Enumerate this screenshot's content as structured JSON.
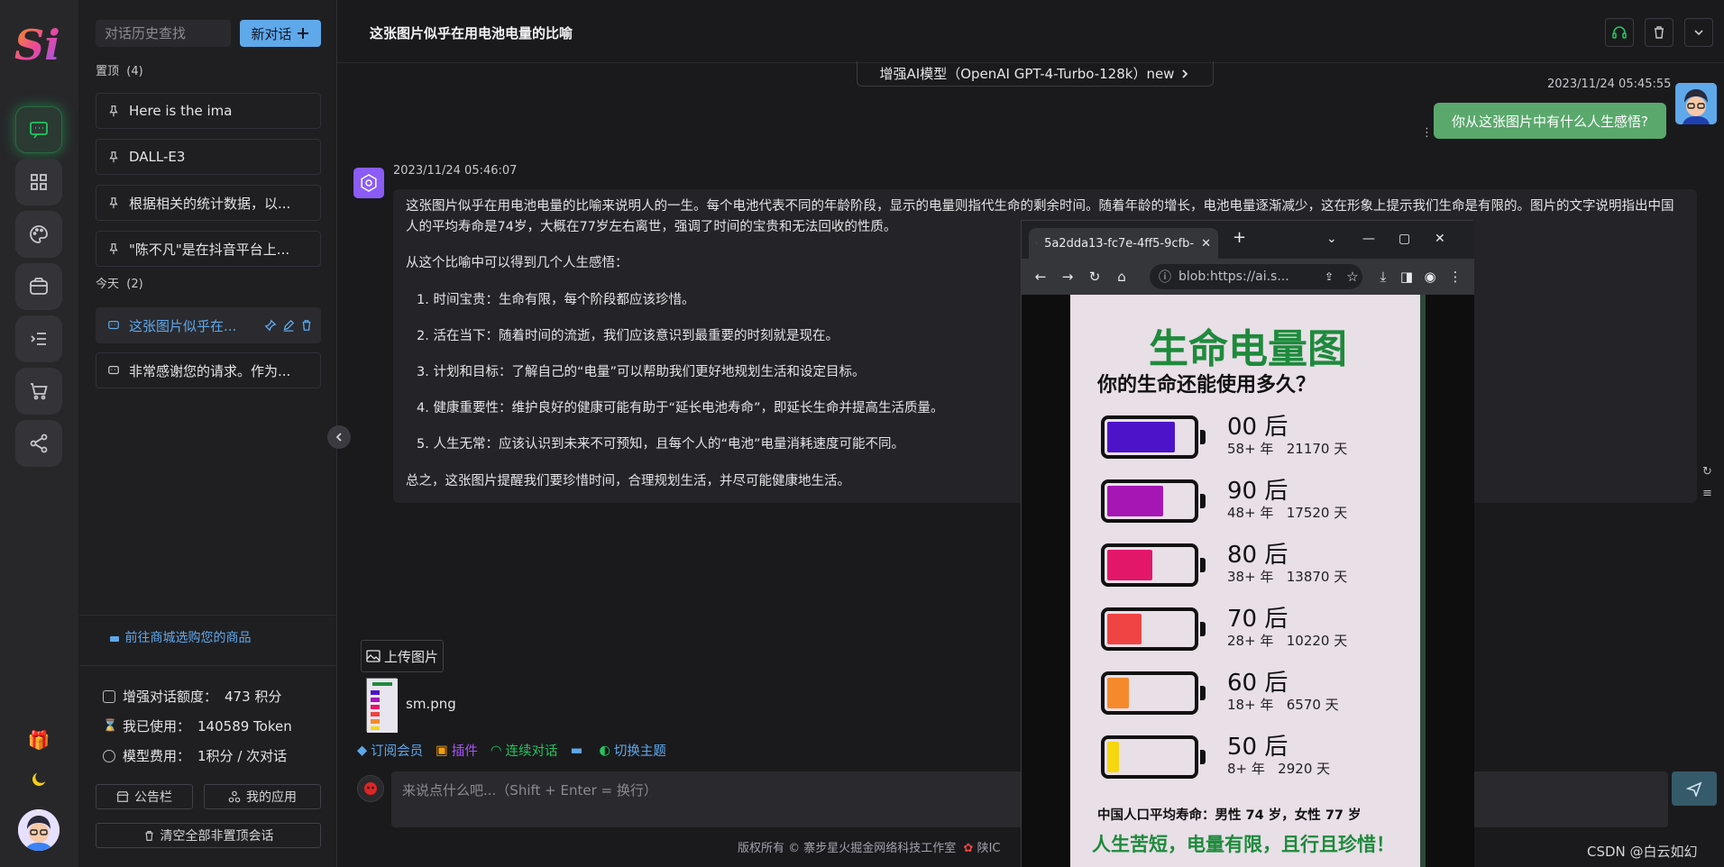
{
  "sidebar": {
    "search_placeholder": "对话历史查找",
    "new_chat_label": "新对话",
    "pinned_label": "置顶",
    "pinned_count": "(4)",
    "pinned_items": [
      "Here is the ima",
      "DALL-E3",
      "根据相关的统计数据，以...",
      "\"陈不凡\"是在抖音平台上..."
    ],
    "today_label": "今天",
    "today_count": "(2)",
    "today_items": [
      "这张图片似乎在...",
      "非常感谢您的请求。作为..."
    ],
    "shop_link": "前往商城选购您的商品",
    "stats": [
      {
        "label": "增强对话额度：",
        "value": "473 积分"
      },
      {
        "label": "我已使用：",
        "value": "140589 Token"
      },
      {
        "label": "模型费用：",
        "value": "1积分 / 次对话"
      }
    ],
    "notice_button": "公告栏",
    "apps_button": "我的应用",
    "clear_button": "清空全部非置顶会话"
  },
  "header": {
    "title": "这张图片似乎在用电池电量的比喻",
    "model_pill": "增强AI模型（OpenAI GPT-4-Turbo-128k）new"
  },
  "chat": {
    "user_time": "2023/11/24 05:45:55",
    "user_message": "你从这张图片中有什么人生感悟?",
    "bot_time": "2023/11/24 05:46:07",
    "bot_intro": "这张图片似乎在用电池电量的比喻来说明人的一生。每个电池代表不同的年龄阶段，显示的电量则指代生命的剩余时间。随着年龄的增长，电池电量逐渐减少，这在形象上提示我们生命是有限的。图片的文字说明指出中国人的平均寿命是74岁，大概在77岁左右离世，强调了时间的宝贵和无法回收的性质。",
    "bot_lead": "从这个比喻中可以得到几个人生感悟：",
    "bot_points": [
      "1. 时间宝贵：生命有限，每个阶段都应该珍惜。",
      "2. 活在当下：随着时间的流逝，我们应该意识到最重要的时刻就是现在。",
      "3. 计划和目标：了解自己的“电量”可以帮助我们更好地规划生活和设定目标。",
      "4. 健康重要性：维护良好的健康可能有助于“延长电池寿命”，即延长生命并提高生活质量。",
      "5. 人生无常：应该认识到未来不可预知，且每个人的“电池”电量消耗速度可能不同。"
    ],
    "bot_conclusion": "总之，这张图片提醒我们要珍惜时间，合理规划生活，并尽可能健康地生活。"
  },
  "composer": {
    "upload_label": "上传图片",
    "attachment_name": "sm.png",
    "tools": [
      {
        "label": "订阅会员",
        "color": "#5fa8ea"
      },
      {
        "label": "插件",
        "color": "#a855f7"
      },
      {
        "label": "连续对话",
        "color": "#22c55e"
      },
      {
        "label": "",
        "color": "#5fa8ea"
      },
      {
        "label": "切换主题",
        "color": "#5fa8ea"
      }
    ],
    "placeholder": "来说点什么吧...（Shift + Enter = 换行）"
  },
  "footer": {
    "copyright": "版权所有 © 寨步星火掘金网络科技工作室",
    "extra": "陕IC",
    "watermark": "CSDN @白云如幻"
  },
  "popup": {
    "tab_title": "5a2dda13-fc7e-4ff5-9cfb-",
    "url": "blob:https://ai.s...",
    "poster": {
      "title": "生命电量图",
      "subtitle": "你的生命还能使用多久？",
      "generations": [
        {
          "gen": "00 后",
          "detail": "58+ 年   21170 天",
          "level": 0.8,
          "color": "#4b14c8"
        },
        {
          "gen": "90 后",
          "detail": "48+ 年   17520 天",
          "level": 0.66,
          "color": "#a516b4"
        },
        {
          "gen": "80 后",
          "detail": "38+ 年   13870 天",
          "level": 0.53,
          "color": "#e3176a"
        },
        {
          "gen": "70 后",
          "detail": "28+ 年   10220 天",
          "level": 0.4,
          "color": "#ef4444"
        },
        {
          "gen": "60 后",
          "detail": "18+ 年   6570 天",
          "level": 0.25,
          "color": "#f58a2c"
        },
        {
          "gen": "50 后",
          "detail": "8+ 年   2920 天",
          "level": 0.14,
          "color": "#f5d60f"
        }
      ],
      "footer_line1": "中国人口平均寿命：男性 74 岁，女性 77 岁",
      "footer_line2": "人生苦短，电量有限，且行且珍惜！"
    }
  }
}
